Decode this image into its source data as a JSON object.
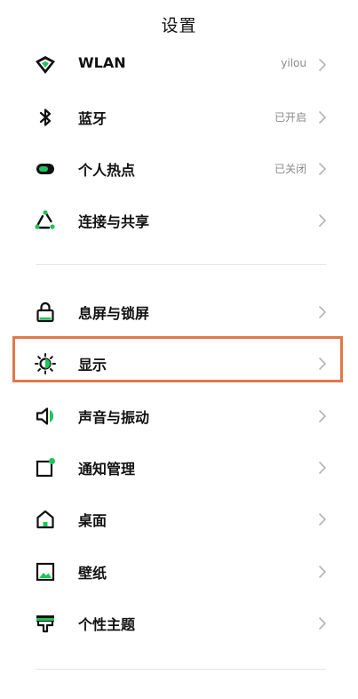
{
  "header": {
    "title": "设置"
  },
  "accent_color": "#21c35a",
  "highlight_color": "#e07848",
  "sections": [
    {
      "items": [
        {
          "key": "wlan",
          "label": "WLAN",
          "value": "yilou",
          "icon": "wifi-icon"
        },
        {
          "key": "bluetooth",
          "label": "蓝牙",
          "value": "已开启",
          "icon": "bluetooth-icon"
        },
        {
          "key": "hotspot",
          "label": "个人热点",
          "value": "已关闭",
          "icon": "hotspot-icon"
        },
        {
          "key": "connection-sharing",
          "label": "连接与共享",
          "value": "",
          "icon": "share-icon"
        }
      ]
    },
    {
      "items": [
        {
          "key": "lockscreen",
          "label": "息屏与锁屏",
          "value": "",
          "icon": "lock-icon"
        },
        {
          "key": "display",
          "label": "显示",
          "value": "",
          "icon": "brightness-icon"
        },
        {
          "key": "sound",
          "label": "声音与振动",
          "value": "",
          "icon": "speaker-icon"
        },
        {
          "key": "notifications",
          "label": "通知管理",
          "value": "",
          "icon": "notification-icon"
        },
        {
          "key": "desktop",
          "label": "桌面",
          "value": "",
          "icon": "home-icon"
        },
        {
          "key": "wallpaper",
          "label": "壁纸",
          "value": "",
          "icon": "wallpaper-icon"
        },
        {
          "key": "theme",
          "label": "个性主题",
          "value": "",
          "icon": "theme-icon"
        }
      ]
    }
  ]
}
